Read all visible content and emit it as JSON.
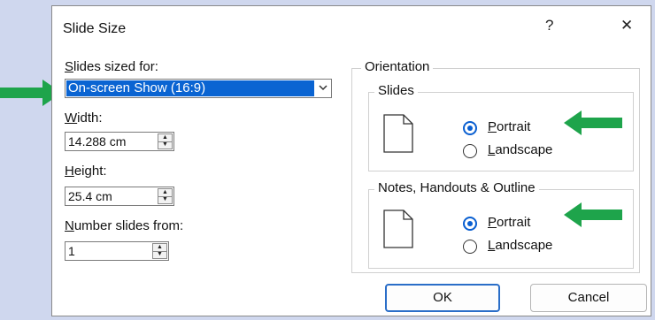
{
  "dialog": {
    "title": "Slide Size",
    "help_glyph": "?",
    "close_glyph": "✕"
  },
  "left": {
    "slides_sized_for": {
      "label": "lides sized for:",
      "mnemonic": "S",
      "value": "On-screen Show (16:9)"
    },
    "width": {
      "label": "idth:",
      "mnemonic": "W",
      "value": "14.288 cm"
    },
    "height": {
      "label": "eight:",
      "mnemonic": "H",
      "value": "25.4 cm"
    },
    "number_from": {
      "label": "umber slides from:",
      "mnemonic": "N",
      "value": "1"
    }
  },
  "orientation": {
    "title": "Orientation",
    "slides": {
      "title": "Slides",
      "portrait": {
        "mnemonic": "P",
        "rest": "ortrait",
        "selected": true
      },
      "landscape": {
        "mnemonic": "L",
        "rest": "andscape",
        "selected": false
      }
    },
    "notes": {
      "title": "Notes, Handouts & Outline",
      "portrait": {
        "mnemonic": "P",
        "rest": "ortrait",
        "selected": true
      },
      "landscape": {
        "mnemonic": "L",
        "rest": "andscape",
        "selected": false
      }
    }
  },
  "buttons": {
    "ok": "OK",
    "cancel": "Cancel"
  },
  "colors": {
    "accent": "#0a5fd1",
    "annotation_arrow": "#1ea44b",
    "selection": "#0a64d2"
  },
  "icons": [
    "help-icon",
    "close-icon",
    "chevron-down-icon",
    "page-portrait-icon",
    "green-arrow-annotation"
  ]
}
